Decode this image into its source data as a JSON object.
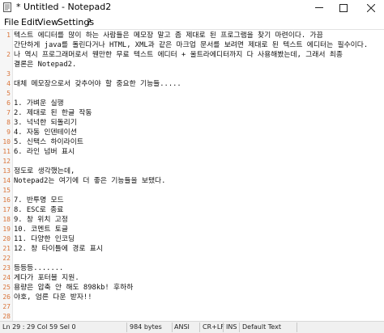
{
  "window": {
    "title": "* Untitled - Notepad2"
  },
  "menu": {
    "file": "File",
    "edit": "Edit",
    "view": "View",
    "settings": "Settings",
    "help": "?"
  },
  "lines": [
    {
      "num": "1",
      "text": "텍스트 에디터를 많이 하는 사람들은 메모장 말고 좀 제대로 된 프로그램을 찾기 마련이다. 가끔"
    },
    {
      "num": "",
      "text": "간단하게 java를 돌린다거나 HTML, XML과 같은 마크업 문서를 보려면 제대로 된 텍스트 에디터는 필수이다."
    },
    {
      "num": "2",
      "text": "나 역시 프로그래머로서 웬만한 무료 텍스트 에디터 + 울트라에디터까지 다 사용해봤는데, 그래서 최종"
    },
    {
      "num": "",
      "text": "결론은 Notepad2."
    },
    {
      "num": "3",
      "text": ""
    },
    {
      "num": "4",
      "text": "대체 메모장으로서 갖추어야 할 중요한 기능들....."
    },
    {
      "num": "5",
      "text": ""
    },
    {
      "num": "6",
      "text": "1. 가벼운 실행"
    },
    {
      "num": "7",
      "text": "2. 제대로 된 한글 작동"
    },
    {
      "num": "8",
      "text": "3. 넉넉한 되돌리기"
    },
    {
      "num": "9",
      "text": "4. 자동 인덴테이션"
    },
    {
      "num": "10",
      "text": "5. 신택스 하이라이트"
    },
    {
      "num": "11",
      "text": "6. 라인 넘버 표시"
    },
    {
      "num": "12",
      "text": ""
    },
    {
      "num": "13",
      "text": "정도로 생각했는데,"
    },
    {
      "num": "14",
      "text": "Notepad2는 여기에 더 좋은 기능들을 보탰다."
    },
    {
      "num": "15",
      "text": ""
    },
    {
      "num": "16",
      "text": "7. 반투명 모드"
    },
    {
      "num": "17",
      "text": "8. ESC로 종료"
    },
    {
      "num": "18",
      "text": "9. 창 위치 고정"
    },
    {
      "num": "19",
      "text": "10. 코멘트 토글"
    },
    {
      "num": "20",
      "text": "11. 다양한 인코딩"
    },
    {
      "num": "21",
      "text": "12. 창 타이틀에 경로 표시"
    },
    {
      "num": "22",
      "text": ""
    },
    {
      "num": "23",
      "text": "등등등......."
    },
    {
      "num": "24",
      "text": "게다가 포터블 지원."
    },
    {
      "num": "25",
      "text": "용량은 압축 안 해도 898kb! 후하하"
    },
    {
      "num": "26",
      "text": "야호, 엄른 다운 받자!!"
    },
    {
      "num": "27",
      "text": ""
    },
    {
      "num": "28",
      "text": ""
    },
    {
      "num": "29",
      "text": ""
    }
  ],
  "status": {
    "position": "Ln 29 : 29   Col 59   Sel 0",
    "size": "984 bytes",
    "encoding": "ANSI",
    "eol": "CR+LF",
    "ins": "INS",
    "scheme": "Default Text"
  },
  "colors": {
    "line_number": "#d9743a",
    "status_bg": "#f0f0f0"
  }
}
